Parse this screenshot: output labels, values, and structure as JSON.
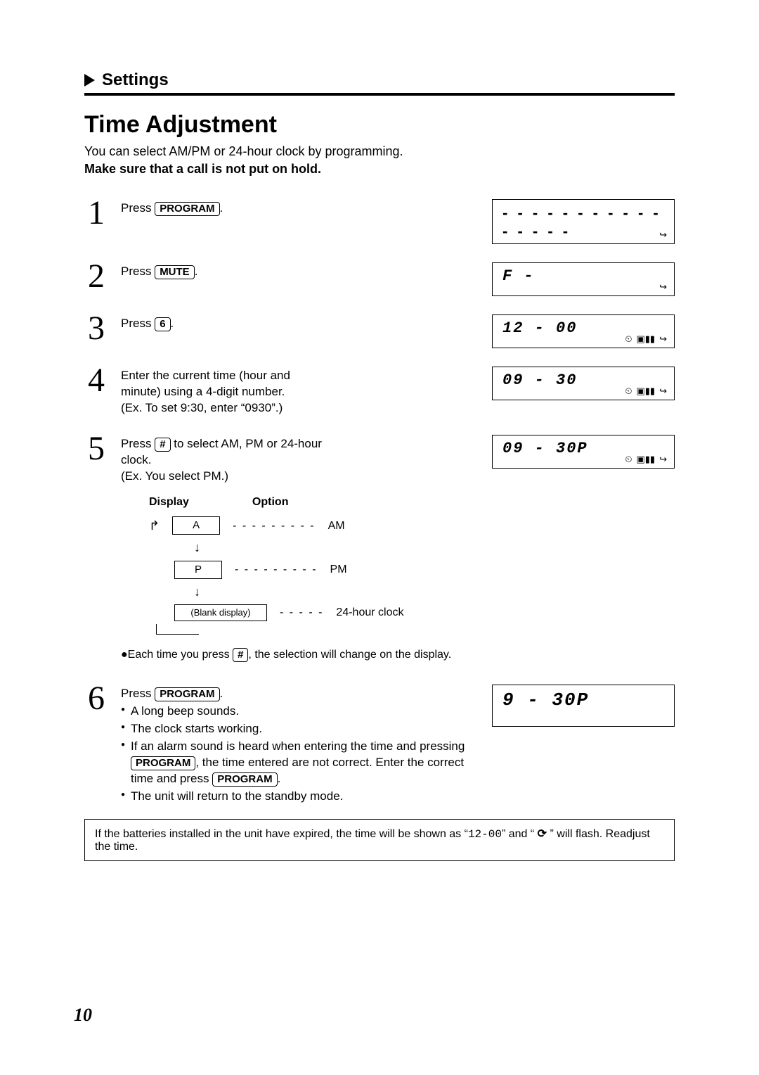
{
  "section_label": "Settings",
  "title": "Time Adjustment",
  "intro1": "You can select AM/PM or 24-hour clock by programming.",
  "intro2": "Make sure that a call is not put on hold.",
  "buttons": {
    "program": "PROGRAM",
    "mute": "MUTE",
    "six": "6",
    "hash": "#"
  },
  "steps": {
    "s1": {
      "num": "1",
      "pre": "Press ",
      "post": "."
    },
    "s2": {
      "num": "2",
      "pre": "Press ",
      "post": "."
    },
    "s3": {
      "num": "3",
      "pre": "Press ",
      "post": "."
    },
    "s4": {
      "num": "4",
      "l1": "Enter the current time (hour and",
      "l2": "minute) using a 4-digit number.",
      "l3": "(Ex. To set 9:30, enter “0930”.)"
    },
    "s5": {
      "num": "5",
      "l1a": "Press ",
      "l1b": " to select AM, PM or 24-hour",
      "l2": "clock.",
      "l3": "(Ex. You select PM.)"
    },
    "s6": {
      "num": "6",
      "pre": "Press ",
      "post": ".",
      "b1": "A long beep sounds.",
      "b2": "The clock starts working.",
      "b3a": "If an alarm sound is heard when entering the time and pressing ",
      "b3b": ", the time entered are not correct. Enter the correct time and press ",
      "b3c": ".",
      "b4": "The unit will return to the standby mode."
    }
  },
  "display_table": {
    "head_display": "Display",
    "head_option": "Option",
    "row_a": {
      "box": "A",
      "opt": "AM"
    },
    "row_p": {
      "box": "P",
      "opt": "PM"
    },
    "row_blank": {
      "box": "(Blank display)",
      "opt": "24-hour clock"
    },
    "dashes_short": "- - - - - - - - -",
    "dashes_tiny": "- - - - -"
  },
  "hash_note_a": "Each time you press ",
  "hash_note_b": ", the selection will change on the display.",
  "lcd": {
    "d1": "- - - - - - - - - - - - - - - -",
    "d2": "F -",
    "d3": "12 - 00",
    "d4": "09 - 30",
    "d5": "09 - 30P",
    "d6": " 9 - 30P"
  },
  "note": {
    "a": "If the batteries installed in the unit have expired, the time will be shown as “",
    "mono": "12-00",
    "b": "” and “ ",
    "c": " ” will flash. Readjust the time."
  },
  "page_number": "10"
}
